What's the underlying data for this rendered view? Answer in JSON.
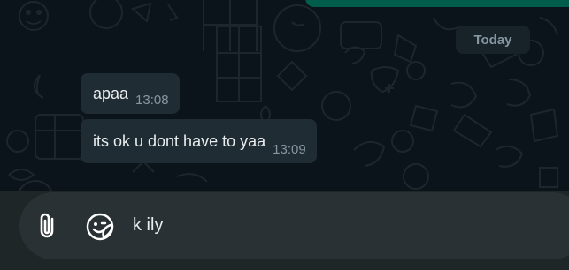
{
  "chat": {
    "date_divider": "Today",
    "messages": [
      {
        "text": "apaa",
        "time": "13:08"
      },
      {
        "text": "its ok u dont have to yaa",
        "time": "13:09"
      }
    ]
  },
  "composer": {
    "input_value": "k ily",
    "attach_icon": "paperclip-icon",
    "sticker_icon": "sticker-icon"
  },
  "colors": {
    "background": "#0b141a",
    "bubble": "#202c33",
    "accent": "#005c4b",
    "text": "#e9edef",
    "muted": "#8696a0"
  }
}
